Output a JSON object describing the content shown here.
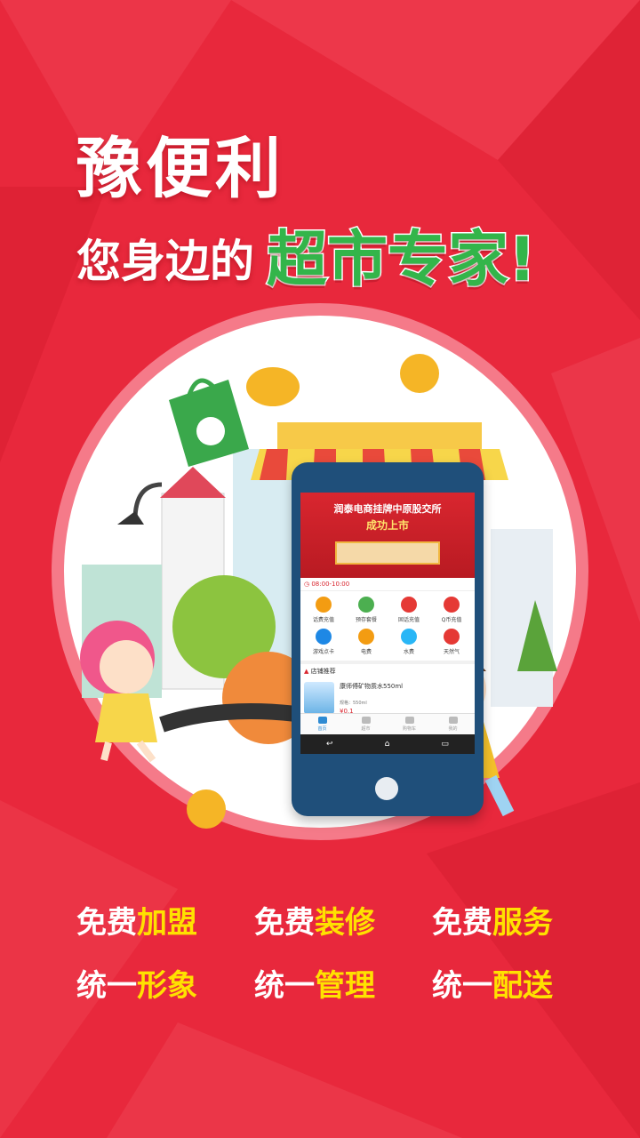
{
  "colors": {
    "background": "#e8283c",
    "accent_green": "#33b54a",
    "highlight_yellow": "#ffe100",
    "phone_body": "#1f4f7a"
  },
  "headline": {
    "brand": "豫便利",
    "tagline_prefix": "您身边的",
    "tagline_accent": "超市专家!"
  },
  "phone": {
    "banner_line1": "润泰电商挂牌中原股交所",
    "banner_line2": "成功上市",
    "hours": "08:00-10:00",
    "services": [
      {
        "label": "话费充值",
        "icon": "phone-icon",
        "color": "#f39c12"
      },
      {
        "label": "预存套餐",
        "icon": "sim-icon",
        "color": "#4caf50"
      },
      {
        "label": "固话充值",
        "icon": "landline-icon",
        "color": "#e53935"
      },
      {
        "label": "Q币充值",
        "icon": "penguin-icon",
        "color": "#e53935"
      },
      {
        "label": "游戏点卡",
        "icon": "gamepad-icon",
        "color": "#1e88e5"
      },
      {
        "label": "电费",
        "icon": "lightning-icon",
        "color": "#f39c12"
      },
      {
        "label": "水费",
        "icon": "water-drop-icon",
        "color": "#29b6f6"
      },
      {
        "label": "天然气",
        "icon": "flame-icon",
        "color": "#e53935"
      }
    ],
    "recommend_title": "店铺推荐",
    "product": {
      "name": "康师傅矿物质水550ml",
      "spec": "规格：550ml",
      "price": "¥0.1"
    },
    "tabs": [
      "首页",
      "超市",
      "购物车",
      "我的"
    ],
    "nav_buttons": [
      "↩",
      "⌂",
      "▭"
    ]
  },
  "slogans": [
    {
      "prefix": "免费",
      "highlight": "加盟"
    },
    {
      "prefix": "免费",
      "highlight": "装修"
    },
    {
      "prefix": "免费",
      "highlight": "服务"
    },
    {
      "prefix": "统一",
      "highlight": "形象"
    },
    {
      "prefix": "统一",
      "highlight": "管理"
    },
    {
      "prefix": "统一",
      "highlight": "配送"
    }
  ]
}
